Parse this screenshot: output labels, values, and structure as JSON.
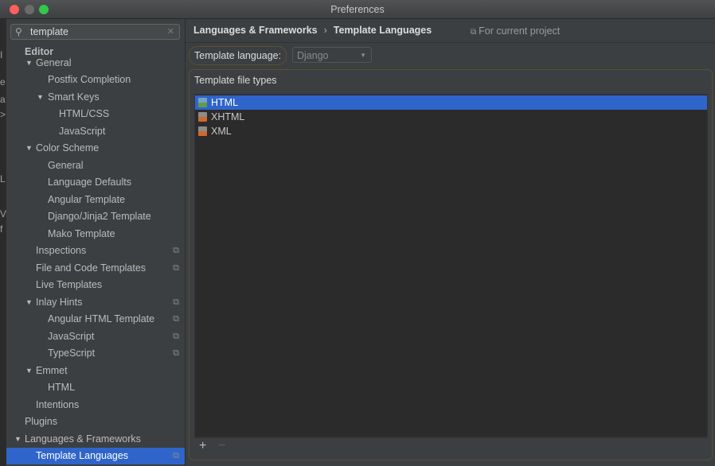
{
  "window": {
    "title": "Preferences"
  },
  "search": {
    "value": "template",
    "icon": "search-icon"
  },
  "ghost_chars": [
    "I",
    "e",
    "a",
    ">",
    "L",
    "V",
    "f"
  ],
  "tree": [
    {
      "label": "Editor",
      "level": 0,
      "bold": true
    },
    {
      "label": "General",
      "level": 1,
      "arrow": "▼"
    },
    {
      "label": "Postfix Completion",
      "level": 2
    },
    {
      "label": "Smart Keys",
      "level": 2,
      "arrow": "▼"
    },
    {
      "label": "HTML/CSS",
      "level": 3
    },
    {
      "label": "JavaScript",
      "level": 3
    },
    {
      "label": "Color Scheme",
      "level": 1,
      "arrow": "▼"
    },
    {
      "label": "General",
      "level": 2
    },
    {
      "label": "Language Defaults",
      "level": 2
    },
    {
      "label": "Angular Template",
      "level": 2
    },
    {
      "label": "Django/Jinja2 Template",
      "level": 2
    },
    {
      "label": "Mako Template",
      "level": 2
    },
    {
      "label": "Inspections",
      "level": 1,
      "project": true
    },
    {
      "label": "File and Code Templates",
      "level": 1,
      "project": true
    },
    {
      "label": "Live Templates",
      "level": 1
    },
    {
      "label": "Inlay Hints",
      "level": 1,
      "arrow": "▼",
      "project": true
    },
    {
      "label": "Angular HTML Template",
      "level": 2,
      "project": true
    },
    {
      "label": "JavaScript",
      "level": 2,
      "project": true
    },
    {
      "label": "TypeScript",
      "level": 2,
      "project": true
    },
    {
      "label": "Emmet",
      "level": 1,
      "arrow": "▼"
    },
    {
      "label": "HTML",
      "level": 2
    },
    {
      "label": "Intentions",
      "level": 1
    },
    {
      "label": "Plugins",
      "level": 0
    },
    {
      "label": "Languages & Frameworks",
      "level": 0,
      "arrow": "▼"
    },
    {
      "label": "Template Languages",
      "level": 1,
      "project": true,
      "selected": true
    }
  ],
  "breadcrumb": {
    "parent": "Languages & Frameworks",
    "separator": "›",
    "current": "Template Languages"
  },
  "for_project": {
    "icon": "project-scope-icon",
    "label": "For current project"
  },
  "template_language": {
    "label": "Template language:",
    "value": "Django"
  },
  "file_types": {
    "title": "Template file types",
    "items": [
      {
        "label": "HTML",
        "icon": "html-file-icon",
        "selected": true
      },
      {
        "label": "XHTML",
        "icon": "xhtml-file-icon",
        "selected": false
      },
      {
        "label": "XML",
        "icon": "xml-file-icon",
        "selected": false
      }
    ],
    "add_label": "+",
    "remove_label": "−"
  }
}
